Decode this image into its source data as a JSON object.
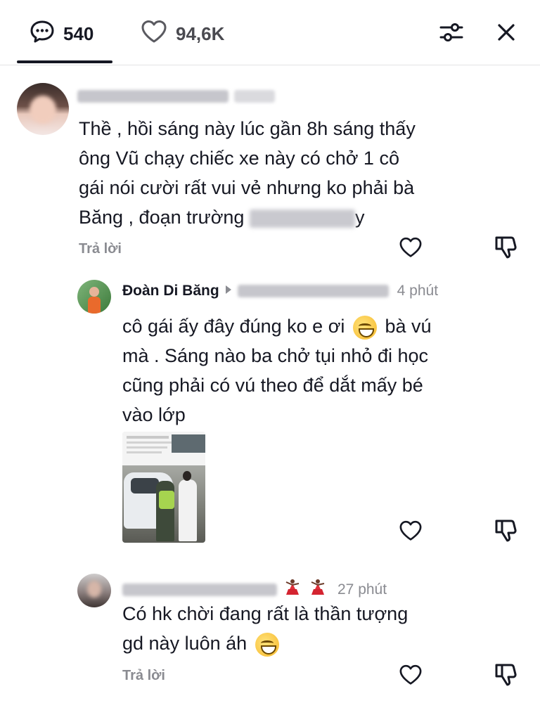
{
  "header": {
    "comments_count": "540",
    "likes_count": "94,6K"
  },
  "comments": [
    {
      "text_line1": "Thề , hồi sáng này lúc gần 8h sáng thấy",
      "text_line2": "ông Vũ chạy chiếc xe này có chở 1 cô",
      "text_line3": "gái nói cười rất vui vẻ nhưng ko phải bà",
      "text_line4_start": "Băng , đoạn trường",
      "text_line4_end": "y",
      "reply_label": "Trả lời"
    },
    {
      "author": "Đoàn Di Băng",
      "time": "4 phút",
      "text_line1_a": "cô gái ấy đây đúng ko e ơi",
      "text_line1_b": "bà vú",
      "text_line2": "mà . Sáng nào ba chở tụi nhỏ đi học",
      "text_line3": "cũng phải có vú theo để dắt mấy bé",
      "text_line4": "vào lớp"
    },
    {
      "time": "27 phút",
      "text_line1": "Có hk chời đang rất là thần tượng",
      "text_line2": "gd này luôn áh",
      "reply_label": "Trả lời"
    }
  ],
  "colors": {
    "text": "#161823",
    "muted": "#8a8b91",
    "divider": "#e3e3e4"
  }
}
